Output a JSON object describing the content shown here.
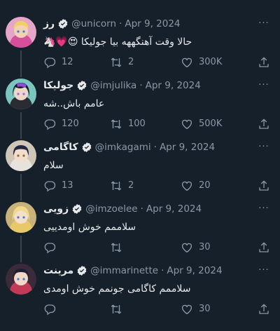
{
  "tweets": [
    {
      "name": "رز",
      "handle": "@unicorn",
      "separator": "·",
      "date": "Apr 9, 2024",
      "text": "حالا وقت آهنگههه بیا جولیکا 😍💗🦄",
      "replies": "12",
      "retweets": "2",
      "likes": "300K",
      "more": "···"
    },
    {
      "name": "جولیکا",
      "handle": "@imjulika",
      "separator": "·",
      "date": "Apr 9, 2024",
      "text": "عامم باش..شه",
      "replies": "120",
      "retweets": "100",
      "likes": "500K",
      "more": "···"
    },
    {
      "name": "کاگامی",
      "handle": "@imkagami",
      "separator": "·",
      "date": "Apr 9, 2024",
      "text": "سلام",
      "replies": "13",
      "retweets": "2",
      "likes": "20",
      "more": "···"
    },
    {
      "name": "زویی",
      "handle": "@imzoelee",
      "separator": "·",
      "date": "Apr 9, 2024",
      "text": "سلاممم خوش اومدییی",
      "replies": "",
      "retweets": "",
      "likes": "30",
      "more": "···"
    },
    {
      "name": "مرینت",
      "handle": "@immarinette",
      "separator": "·",
      "date": "Apr 9, 2024",
      "text": "سلاممم کاگامی جونمم خوش اومدی",
      "replies": "",
      "retweets": "",
      "likes": "30",
      "more": "···"
    }
  ],
  "colors": {
    "background": "#15202b",
    "text": "#e7e9ea",
    "muted": "#8b98a5",
    "thread_line": "#38444d",
    "verified": "#e7e9ea"
  },
  "icons": [
    "reply-icon",
    "retweet-icon",
    "like-icon",
    "share-icon",
    "verified-badge-icon",
    "more-options-icon"
  ]
}
